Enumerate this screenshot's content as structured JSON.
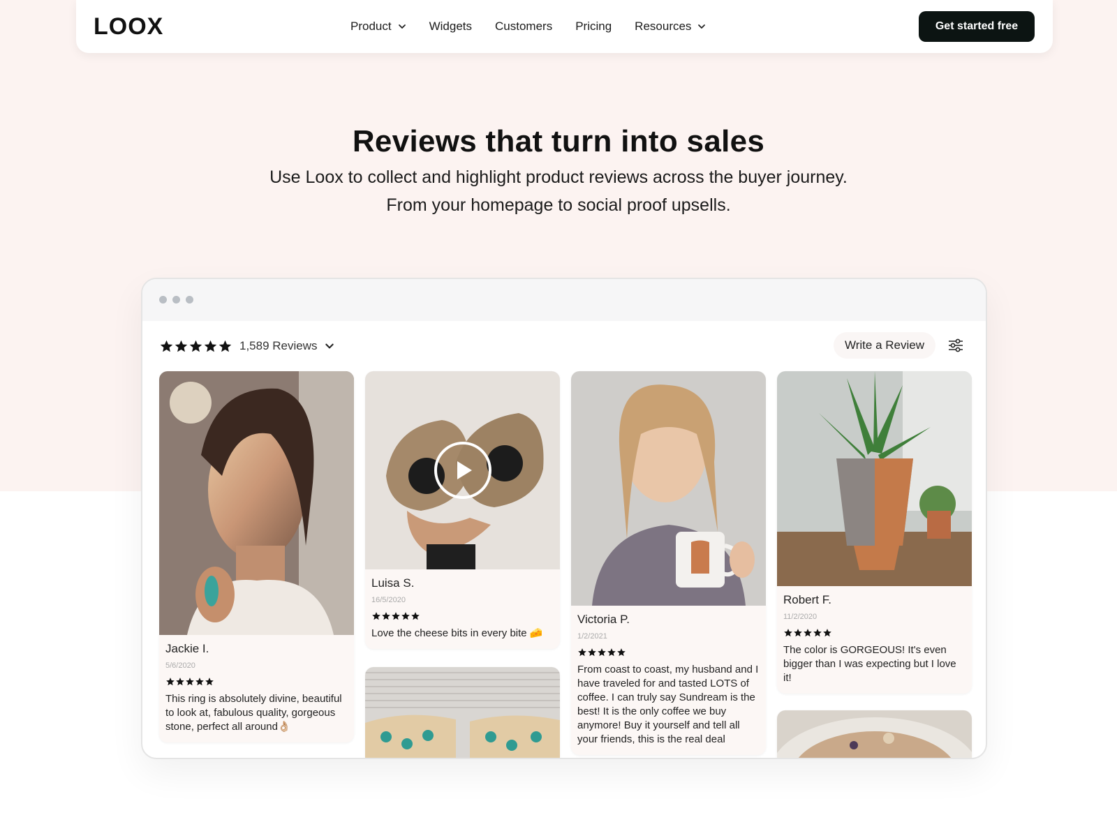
{
  "nav": {
    "logo": "LOOX",
    "links": [
      {
        "label": "Product",
        "has_dropdown": true
      },
      {
        "label": "Widgets",
        "has_dropdown": false
      },
      {
        "label": "Customers",
        "has_dropdown": false
      },
      {
        "label": "Pricing",
        "has_dropdown": false
      },
      {
        "label": "Resources",
        "has_dropdown": true
      }
    ],
    "cta_label": "Get started free"
  },
  "hero": {
    "title": "Reviews that turn into sales",
    "subtitle_line1": "Use Loox to collect and highlight product reviews across the buyer journey.",
    "subtitle_line2": "From your homepage to social proof upsells."
  },
  "widget": {
    "rating_stars": 5,
    "review_count": "1,589 Reviews",
    "write_review_label": "Write a Review",
    "filter_icon": "sliders-icon",
    "reviews": [
      {
        "name": "Jackie I.",
        "date": "5/6/2020",
        "stars": 5,
        "text": "This ring is absolutely divine, beautiful to look at, fabulous quality, gorgeous stone, perfect all around👌🏼"
      },
      {
        "name": "Luisa S.",
        "date": "16/5/2020",
        "stars": 5,
        "text": "Love the cheese bits in every bite 🧀",
        "has_video": true
      },
      {
        "name": "Victoria P.",
        "date": "1/2/2021",
        "stars": 5,
        "text": "From coast to coast, my husband and I have traveled for and tasted LOTS of coffee. I can truly say Sundream is the best! It is the only coffee we buy anymore! Buy it yourself and tell all your friends, this is the real deal"
      },
      {
        "name": "Robert F.",
        "date": "11/2/2020",
        "stars": 5,
        "text": "The color is GORGEOUS! It's even bigger than I was expecting but I love it!"
      }
    ]
  },
  "colors": {
    "hero_bg": "#fcf3f1",
    "cta_bg": "#0c1412",
    "card_bg": "#fcf7f5"
  }
}
